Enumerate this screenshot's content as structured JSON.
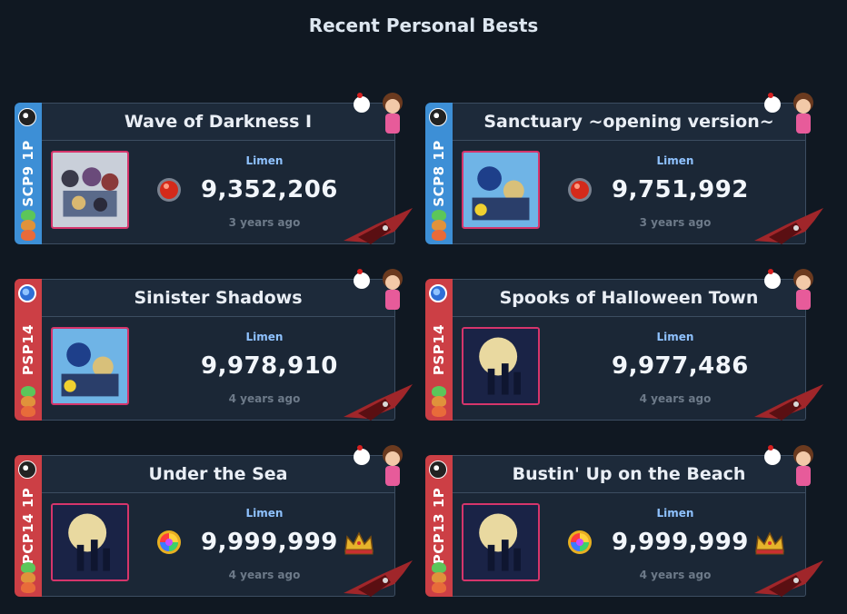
{
  "page": {
    "title": "Recent Personal Bests"
  },
  "colors": {
    "background": "#101822",
    "card": "#1b2736",
    "single_play": "#3d8fd6",
    "double_play": "#cc3f45",
    "jacket_border": "#d6356b",
    "player_name": "#8fc2ff"
  },
  "cards": [
    {
      "title": "Wave of Darkness I",
      "chart": "SCP9 1P",
      "player": "Limen",
      "score": "9,352,206",
      "time": "3 years ago",
      "lamp": "red-clear-lamp-icon",
      "crown": false,
      "jacket": "kh2-party-art"
    },
    {
      "title": "Sanctuary ~opening version~",
      "chart": "SCP8 1P",
      "player": "Limen",
      "score": "9,751,992",
      "time": "3 years ago",
      "lamp": "red-clear-lamp-icon",
      "crown": false,
      "jacket": "kh2-cover-art"
    },
    {
      "title": "Sinister Shadows",
      "chart": "PSP14",
      "player": "Limen",
      "score": "9,978,910",
      "time": "4 years ago",
      "lamp": "none",
      "crown": false,
      "jacket": "kh2-cover-art"
    },
    {
      "title": "Spooks of Halloween Town",
      "chart": "PSP14",
      "player": "Limen",
      "score": "9,977,486",
      "time": "4 years ago",
      "lamp": "none",
      "crown": false,
      "jacket": "kh1-moon-art"
    },
    {
      "title": "Under the Sea",
      "chart": "PCP14 1P",
      "player": "Limen",
      "score": "9,999,999",
      "time": "4 years ago",
      "lamp": "rainbow-lamp-icon",
      "crown": true,
      "jacket": "kh1-moon-art"
    },
    {
      "title": "Bustin' Up on the Beach",
      "chart": "PCP13 1P",
      "player": "Limen",
      "score": "9,999,999",
      "time": "4 years ago",
      "lamp": "rainbow-lamp-icon",
      "crown": true,
      "jacket": "kh1-moon-art"
    }
  ]
}
